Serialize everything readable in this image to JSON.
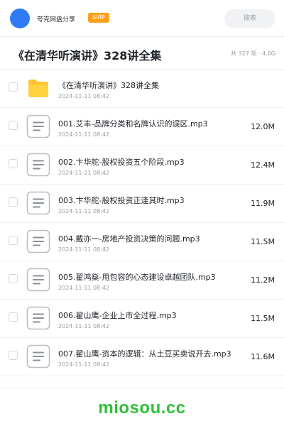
{
  "header": {
    "share_name": "夸克网盘分享",
    "badge": "SVIP",
    "search_label": "搜索",
    "avatar_color": "#2f7bf5",
    "badge_color": "#ff9f1c"
  },
  "folder_header": {
    "title": "《在清华听演讲》328讲全集",
    "summary": "共 327 项 · 4.6G"
  },
  "files": [
    {
      "name": "《在清华听演讲》328讲全集",
      "date": "2024-11-11 08:42",
      "size": "",
      "icon": "folder-icon"
    },
    {
      "name": "001.艾丰-品牌分类和名牌认识的误区.mp3",
      "date": "2024-11-11 08:42",
      "size": "12.0M",
      "icon": "audio-file-icon"
    },
    {
      "name": "002.卞华舵-股权投资五个阶段.mp3",
      "date": "2024-11-11 08:42",
      "size": "12.4M",
      "icon": "audio-file-icon"
    },
    {
      "name": "003.卞华舵-股权投资正逢其时.mp3",
      "date": "2024-11-11 08:42",
      "size": "11.9M",
      "icon": "audio-file-icon"
    },
    {
      "name": "004.戴亦一-房地产投资决策的问题.mp3",
      "date": "2024-11-11 08:42",
      "size": "11.5M",
      "icon": "audio-file-icon"
    },
    {
      "name": "005.翟鸿燊-用包容的心态建设卓越团队.mp3",
      "date": "2024-11-11 08:42",
      "size": "11.2M",
      "icon": "audio-file-icon"
    },
    {
      "name": "006.翟山鹰-企业上市全过程.mp3",
      "date": "2024-11-11 08:42",
      "size": "11.5M",
      "icon": "audio-file-icon"
    },
    {
      "name": "007.翟山鹰-资本的逻辑：从土豆买卖说开去.mp3",
      "date": "2024-11-11 08:42",
      "size": "11.6M",
      "icon": "audio-file-icon"
    }
  ],
  "watermark": "miosou.cc"
}
